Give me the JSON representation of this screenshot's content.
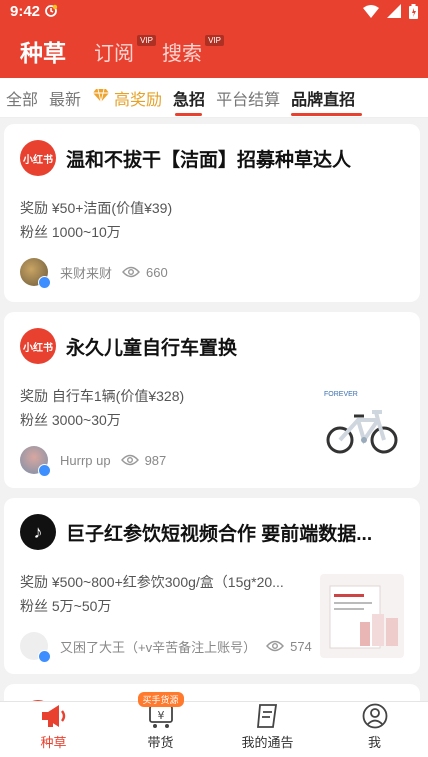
{
  "status": {
    "time": "9:42"
  },
  "nav": {
    "tabs": [
      {
        "label": "种草",
        "vip": ""
      },
      {
        "label": "订阅",
        "vip": "VIP"
      },
      {
        "label": "搜索",
        "vip": "VIP"
      }
    ]
  },
  "categories": [
    "全部",
    "最新",
    "高奖励",
    "急招",
    "平台结算",
    "品牌直招"
  ],
  "cards": [
    {
      "title": "温和不拔干【洁面】招募种草达人",
      "logo_text": "小红书",
      "reward": "奖励 ¥50+洁面(价值¥39)",
      "fans": "粉丝 1000~10万",
      "user": "来财来财",
      "views": "660"
    },
    {
      "title": "永久儿童自行车置换",
      "logo_text": "小红书",
      "reward": "奖励 自行车1辆(价值¥328)",
      "fans": "粉丝 3000~30万",
      "user": "Hurrp  up",
      "views": "987",
      "thumb_text": "FOREVER"
    },
    {
      "title": "巨子红参饮短视频合作 要前端数据...",
      "logo_text": "♪",
      "reward": "奖励 ¥500~800+红参饮300g/盒（15g*20...",
      "fans": "粉丝 5万~50万",
      "user": "又困了大王（+v辛苦备注上账号）",
      "views": "574"
    }
  ],
  "tabbar": {
    "items": [
      {
        "label": "种草"
      },
      {
        "label": "带货",
        "badge": "买手货源"
      },
      {
        "label": "我的通告"
      },
      {
        "label": "我"
      }
    ]
  },
  "colors": {
    "accent": "#e8412f",
    "gold": "#e5a22a",
    "verified": "#3d8fff"
  }
}
